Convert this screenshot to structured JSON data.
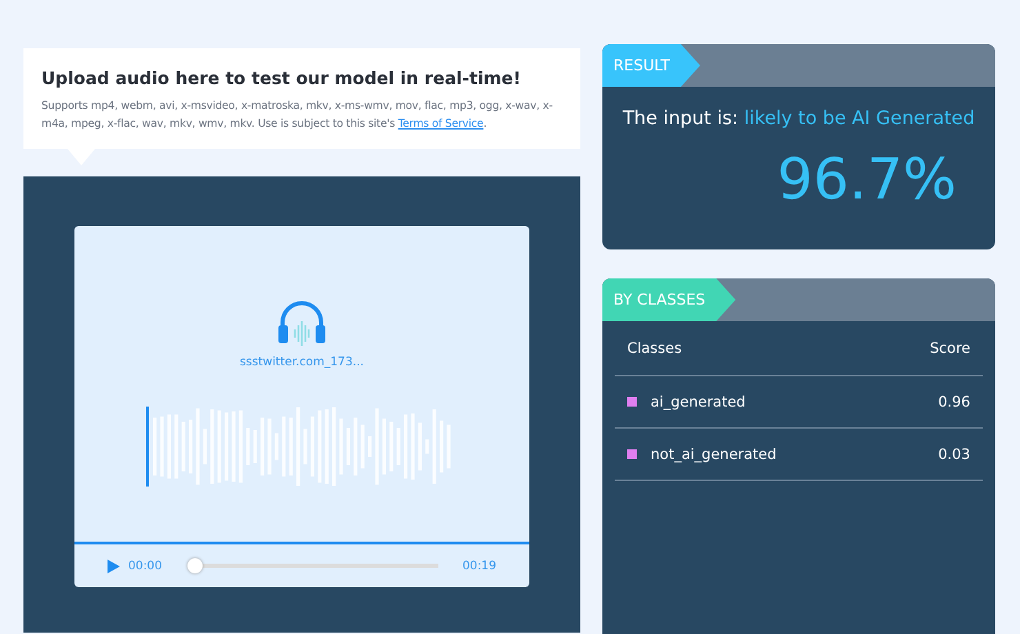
{
  "upload": {
    "title": "Upload audio here to test our model in real-time!",
    "description": "Supports mp4, webm, avi, x-msvideo, x-matroska, mkv, x-ms-wmv, mov, flac, mp3, ogg, x-wav, x-m4a, mpeg, x-flac, wav, mkv, wmv, mkv. Use is subject to this site's ",
    "link": "Terms of Service",
    "after_link": "."
  },
  "player": {
    "file_name": "ssstwitter.com_173...",
    "current_time": "00:00",
    "duration": "00:19",
    "level": 0
  },
  "result": {
    "tab": "RESULT",
    "prefix": "The input is:",
    "verdict": "likely to be AI Generated",
    "score": "96.7%"
  },
  "classes": {
    "tab": "BY CLASSES",
    "columns": [
      "Classes",
      "Score"
    ],
    "rows": [
      {
        "name": "ai_generated",
        "score": "0.96",
        "color": "#e07ff0"
      },
      {
        "name": "not_ai_generated",
        "score": "0.03",
        "color": "#e07ff0"
      }
    ]
  }
}
